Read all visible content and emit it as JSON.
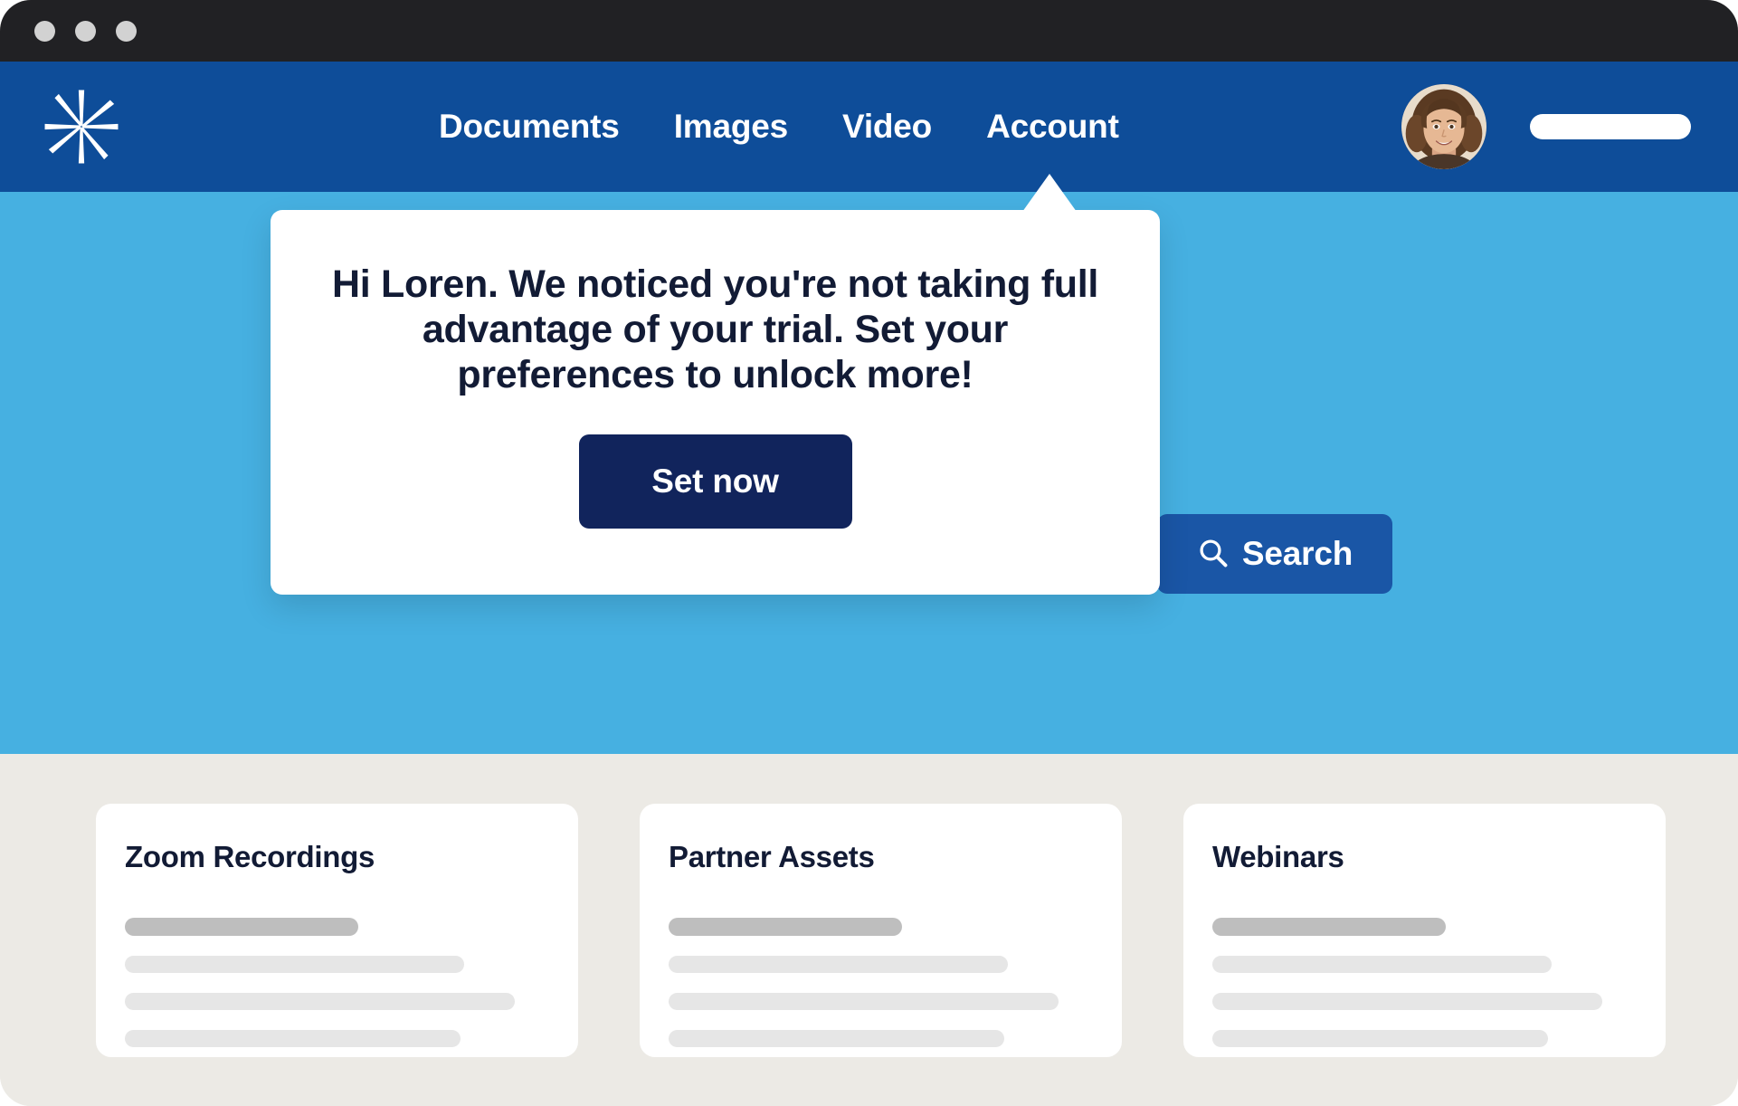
{
  "window": {
    "traffic_lights": [
      "close",
      "minimize",
      "maximize"
    ]
  },
  "navbar": {
    "logo_name": "asterisk-logo",
    "links": [
      {
        "label": "Documents"
      },
      {
        "label": "Images"
      },
      {
        "label": "Video"
      },
      {
        "label": "Account"
      }
    ],
    "avatar_alt": "user-avatar",
    "pill_label": ""
  },
  "hero": {
    "search_button": {
      "label": "Search",
      "icon": "search-icon",
      "color": "#1A56A6"
    },
    "background_color": "#46B0E1"
  },
  "tooltip": {
    "message": "Hi Loren. We noticed you're not taking full advantage of your trial. Set your preferences to unlock more!",
    "cta_label": "Set now",
    "cta_color": "#11245C",
    "anchor": "Account"
  },
  "content": {
    "background_color": "#ECEAE5",
    "cards": [
      {
        "title": "Zoom Recordings",
        "lines": [
          {
            "type": "head",
            "width": "55%"
          },
          {
            "type": "line",
            "width": "80%"
          },
          {
            "type": "line",
            "width": "92%"
          },
          {
            "type": "line",
            "width": "79%"
          }
        ]
      },
      {
        "title": "Partner Assets",
        "lines": [
          {
            "type": "head",
            "width": "55%"
          },
          {
            "type": "line",
            "width": "80%"
          },
          {
            "type": "line",
            "width": "92%"
          },
          {
            "type": "line",
            "width": "79%"
          }
        ]
      },
      {
        "title": "Webinars",
        "lines": [
          {
            "type": "head",
            "width": "55%"
          },
          {
            "type": "line",
            "width": "80%"
          },
          {
            "type": "line",
            "width": "92%"
          },
          {
            "type": "line",
            "width": "79%"
          }
        ]
      }
    ]
  },
  "colors": {
    "titlebar": "#212124",
    "navbar": "#0E4D99",
    "hero": "#46B0E1",
    "content": "#ECEAE5",
    "text_dark": "#121B35"
  }
}
